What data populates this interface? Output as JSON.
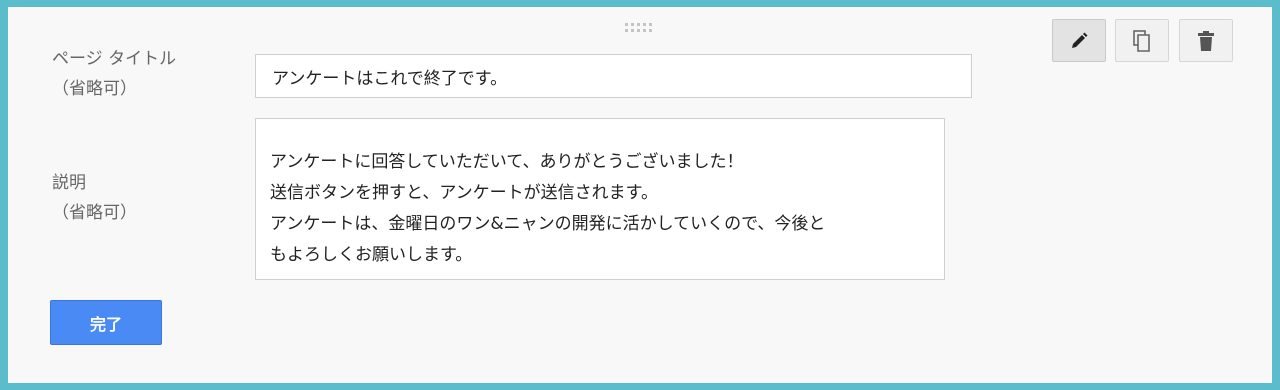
{
  "toolbar": {
    "buttons": [
      {
        "name": "edit",
        "icon": "pencil-icon",
        "active": true
      },
      {
        "name": "copy",
        "icon": "copy-icon",
        "active": false
      },
      {
        "name": "delete",
        "icon": "trash-icon",
        "active": false
      }
    ]
  },
  "form": {
    "page_title_label": "ページ タイトル\n（省略可）",
    "page_title_value": "アンケートはこれで終了です。",
    "description_label": "説明\n（省略可）",
    "description_lines": [
      "アンケートに回答していただいて、ありがとうございました！",
      "送信ボタンを押すと、アンケートが送信されます。",
      "アンケートは、金曜日のワン&ニャンの開発に活かしていくので、今後と",
      "もよろしくお願いします。"
    ],
    "done_label": "完了"
  },
  "colors": {
    "accent": "#4a8af4",
    "frame": "#5bbccb"
  }
}
